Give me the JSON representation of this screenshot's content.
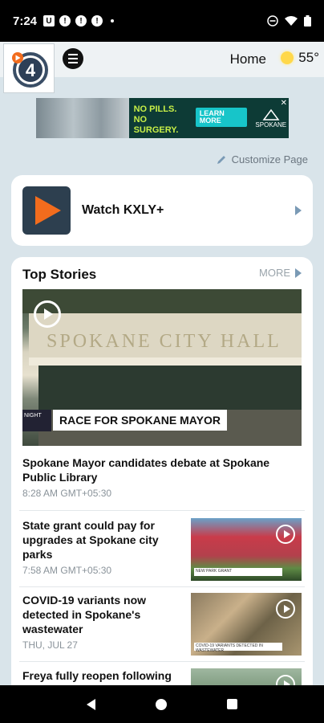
{
  "status_bar": {
    "time": "7:24",
    "left_icons": [
      "u-notification-icon",
      "alert-icon",
      "alert-icon",
      "alert-icon"
    ],
    "right_icons": [
      "do-not-disturb-icon",
      "wifi-icon",
      "battery-icon"
    ]
  },
  "header": {
    "logo_text": "4",
    "home_label": "Home",
    "temperature": "55°"
  },
  "ad": {
    "headline": "NO PILLS. NO SURGERY.",
    "cta": "LEARN MORE",
    "brand": "SPOKANE",
    "close": "✕"
  },
  "customize_label": "Customize Page",
  "watch": {
    "label": "Watch KXLY+"
  },
  "top_stories": {
    "header": "Top Stories",
    "more_label": "MORE",
    "hero": {
      "caption": "RACE FOR SPOKANE MAYOR",
      "tag": "NIGHT",
      "sign_text": "SPOKANE CITY HALL",
      "title": "Spokane Mayor candidates debate at Spokane Public Library",
      "time": "8:28 AM GMT+05:30"
    },
    "items": [
      {
        "title": "State grant could pay for upgrades at Spokane city parks",
        "time": "7:58 AM GMT+05:30",
        "thumb_caption": "NEW PARK GRANT"
      },
      {
        "title": "COVID-19 variants now detected in Spokane's wastewater",
        "time": "THU, JUL 27",
        "thumb_caption": "COVID-19 VARIANTS DETECTED IN WASTEWATER"
      },
      {
        "title": "Freya fully reopen following",
        "time": "",
        "thumb_caption": ""
      }
    ]
  },
  "colors": {
    "background": "#d9e4ea",
    "watch_play_orange": "#f26c1d",
    "accent_blue": "#7a9ab5"
  }
}
